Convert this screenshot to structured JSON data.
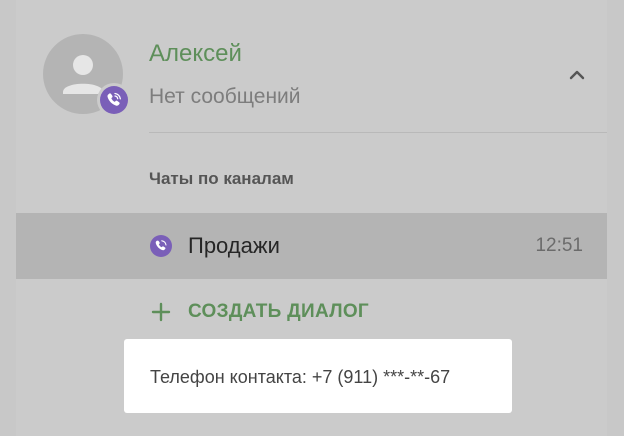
{
  "contact": {
    "name": "Алексей",
    "status": "Нет сообщений"
  },
  "channels": {
    "section_title": "Чаты по каналам",
    "items": [
      {
        "name": "Продажи",
        "time": "12:51",
        "icon": "viber-icon"
      }
    ]
  },
  "actions": {
    "create_dialog_label": "СОЗДАТЬ ДИАЛОГ"
  },
  "tooltip": {
    "text": "Телефон контакта: +7 (911) ***-**-67"
  },
  "colors": {
    "overlay": "#c8c8c8",
    "accent_green": "#5e8f5a",
    "viber_purple": "#7a5fb8",
    "row_selected": "#b4b4b4",
    "tooltip_bg": "#ffffff"
  },
  "icons": {
    "avatar": "person-icon",
    "badge": "viber-icon",
    "collapse": "chevron-up-icon",
    "add": "plus-icon"
  }
}
